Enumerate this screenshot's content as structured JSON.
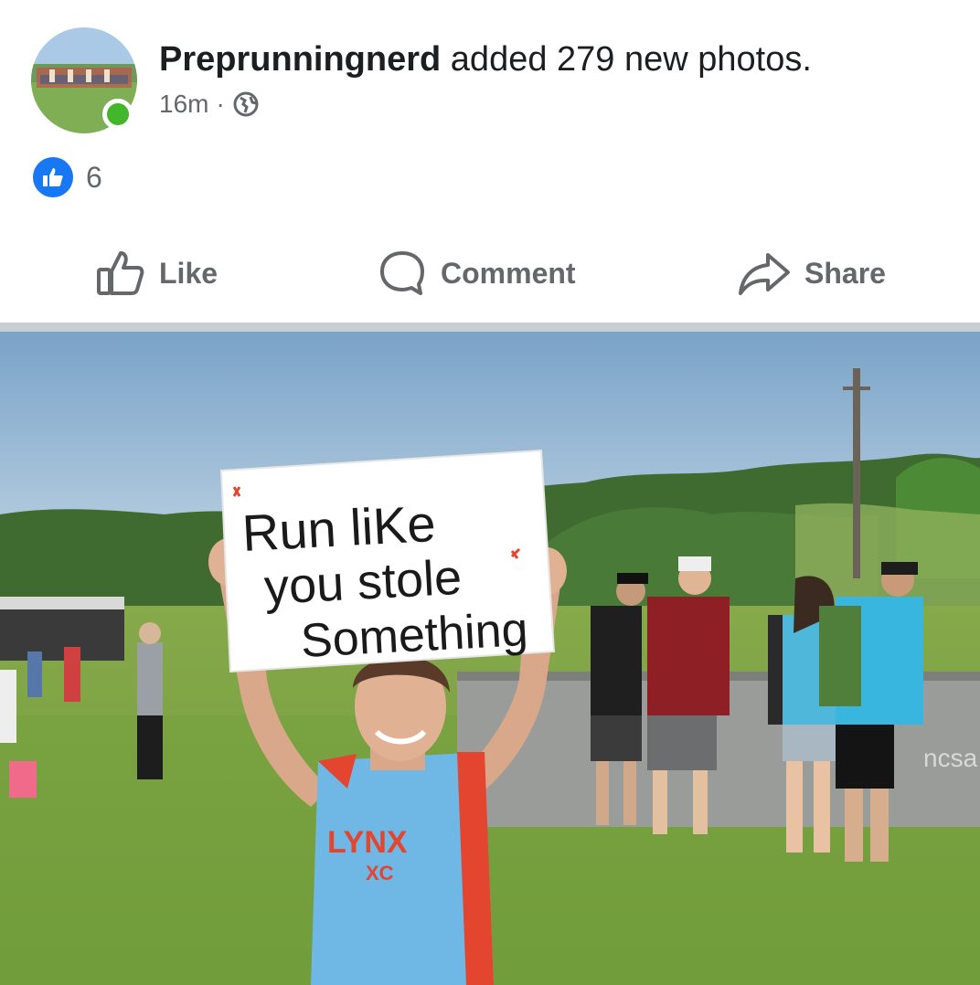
{
  "post": {
    "author": "Preprunningnerd",
    "action_text": "added 279 new photos.",
    "time": "16m",
    "separator": "·",
    "privacy_icon": "globe-icon"
  },
  "reactions": {
    "icon": "like-icon",
    "count": "6"
  },
  "actions": {
    "like_label": "Like",
    "comment_label": "Comment",
    "share_label": "Share"
  },
  "photo": {
    "sign_line1": "Run liKe",
    "sign_line2": "you stole",
    "sign_line3": "Something",
    "jersey_line1": "LYNX",
    "jersey_line2": "XC",
    "banner_text": "ncsa"
  },
  "colors": {
    "brand_blue": "#1877f2",
    "online_green": "#42b72a",
    "text_primary": "#1c1e21",
    "text_secondary": "#65676b"
  }
}
